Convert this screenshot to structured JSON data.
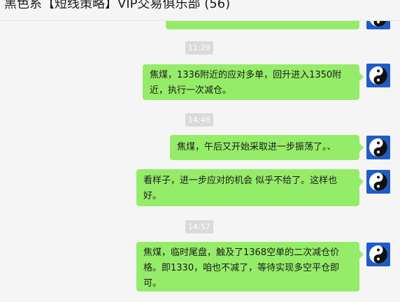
{
  "window": {
    "title": "黑色系【短线策略】VIP交易俱乐部 (56)"
  },
  "messages": [
    {
      "type": "time",
      "text": "11:29"
    },
    {
      "type": "text",
      "text": "焦煤，1336附近的应对多单，回升进入1350附近，执行一次减仓。"
    },
    {
      "type": "time",
      "text": "14:46"
    },
    {
      "type": "text",
      "text": "焦煤，午后又开始采取进一步振荡了。、"
    },
    {
      "type": "text",
      "text": "看样子，进一步应对的机会 似乎不给了。这样也好。"
    },
    {
      "type": "time",
      "text": "14:57"
    },
    {
      "type": "text",
      "text": "焦煤，临时尾盘，触及了1368空单的二次减仓价格。即1330，咱也不减了，等待实现多空平仓即可。"
    }
  ],
  "avatar_icon": "yin-yang-icon",
  "colors": {
    "bubble": "#95ec69",
    "background": "#f5f5f5",
    "avatar": "#1e5cc8"
  }
}
